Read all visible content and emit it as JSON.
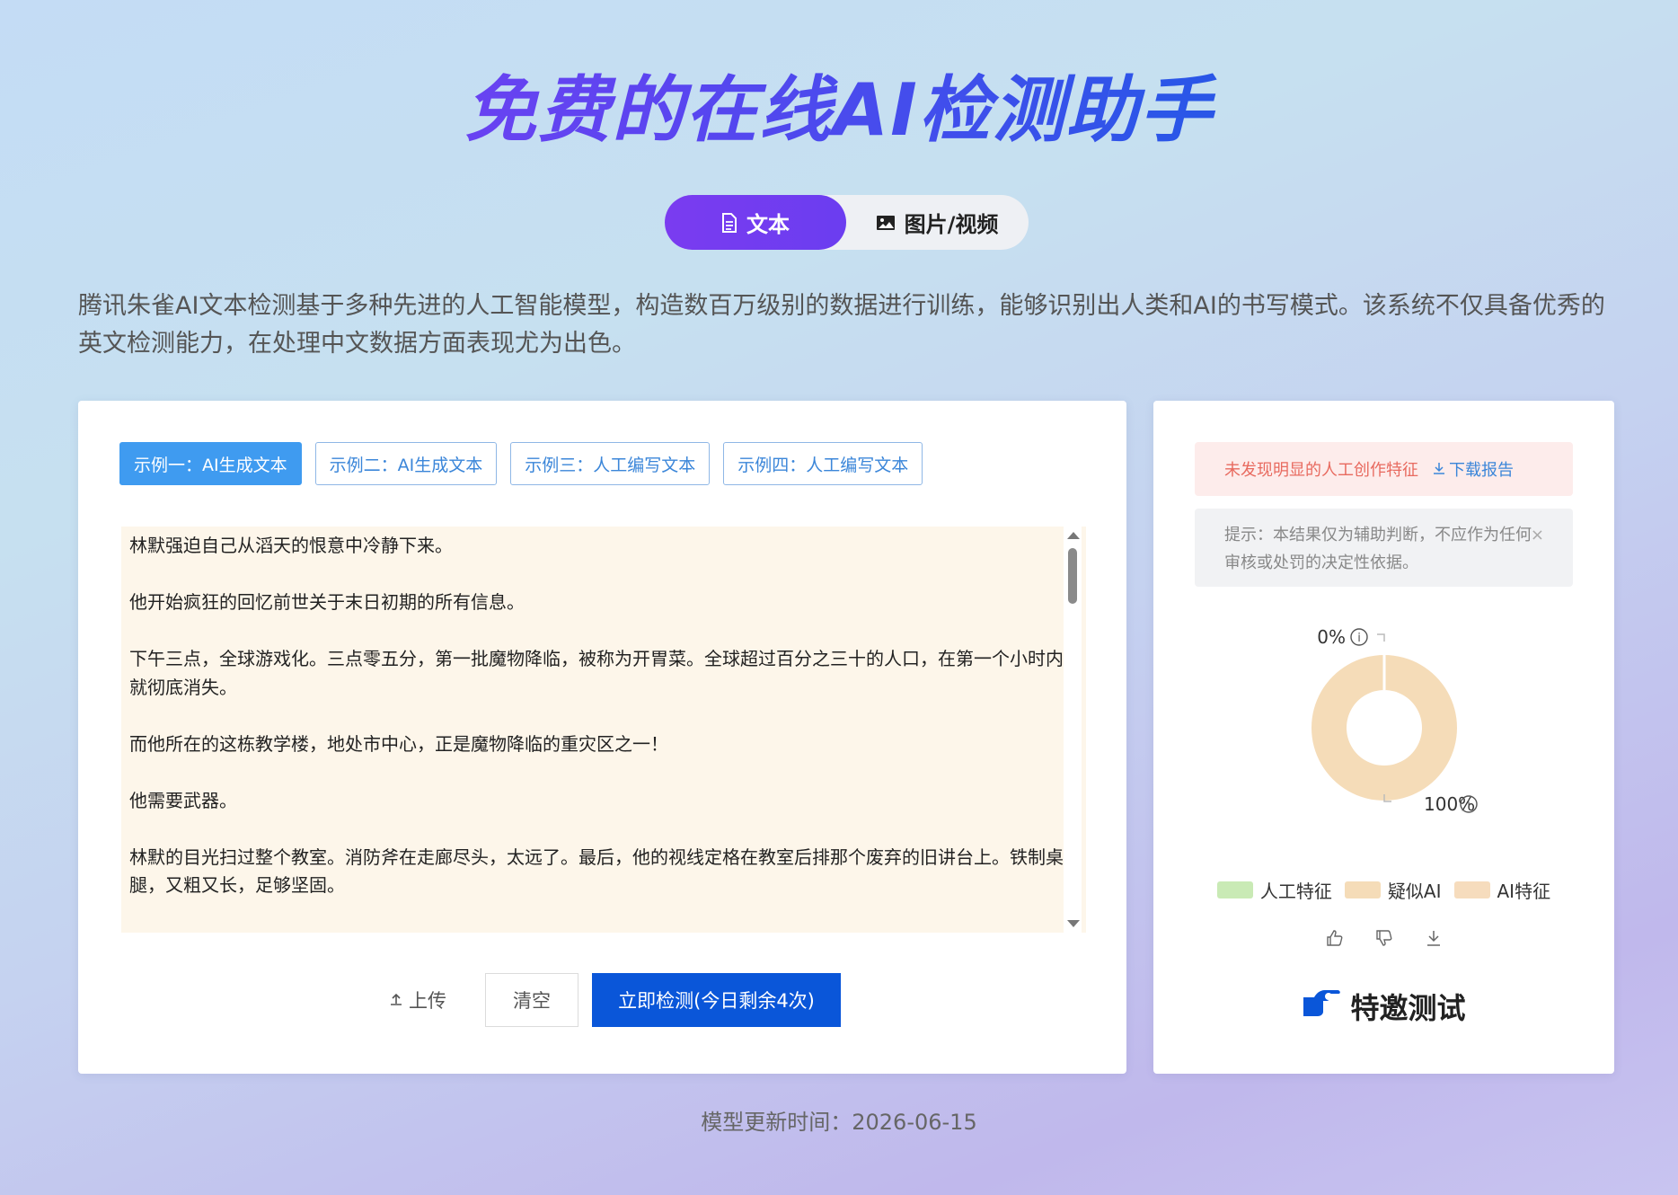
{
  "page": {
    "title": "免费的在线AI检测助手"
  },
  "mode_tabs": [
    {
      "label": "文本",
      "icon": "document-icon",
      "active": true
    },
    {
      "label": "图片/视频",
      "icon": "image-icon",
      "active": false
    }
  ],
  "intro": "腾讯朱雀AI文本检测基于多种先进的人工智能模型，构造数百万级别的数据进行训练，能够识别出人类和AI的书写模式。该系统不仅具备优秀的英文检测能力，在处理中文数据方面表现尤为出色。",
  "examples": [
    {
      "label": "示例一：AI生成文本",
      "active": true
    },
    {
      "label": "示例二：AI生成文本",
      "active": false
    },
    {
      "label": "示例三：人工编写文本",
      "active": false
    },
    {
      "label": "示例四：人工编写文本",
      "active": false
    }
  ],
  "input_text": [
    "林默强迫自己从滔天的恨意中冷静下来。",
    "他开始疯狂的回忆前世关于末日初期的所有信息。",
    "下午三点，全球游戏化。三点零五分，第一批魔物降临，被称为开胃菜。全球超过百分之三十的人口，在第一个小时内就彻底消失。",
    "而他所在的这栋教学楼，地处市中心，正是魔物降临的重灾区之一！",
    "他需要武器。",
    "林默的目光扫过整个教室。消防斧在走廊尽头，太远了。最后，他的视线定格在教室后排那个废弃的旧讲台上。铁制桌腿，又粗又长，足够坚固。"
  ],
  "actions": {
    "upload": "上传",
    "clear": "清空",
    "detect": "立即检测(今日剩余4次)"
  },
  "result": {
    "warning": "未发现明显的人工创作特征",
    "download_report": "下载报告",
    "tip": "提示：本结果仅为辅助判断，不应作为任何审核或处罚的决定性依据。",
    "close_symbol": "×"
  },
  "chart_data": {
    "type": "pie",
    "categories": [
      "人工特征",
      "疑似AI",
      "AI特征"
    ],
    "values": [
      0,
      100,
      0
    ],
    "value_labels": [
      "0%",
      "100%"
    ],
    "colors": [
      "#c9eab5",
      "#f5dcb8",
      "#f6dcbd"
    ]
  },
  "special_test": "特邀测试",
  "footer": "模型更新时间：2026-06-15"
}
